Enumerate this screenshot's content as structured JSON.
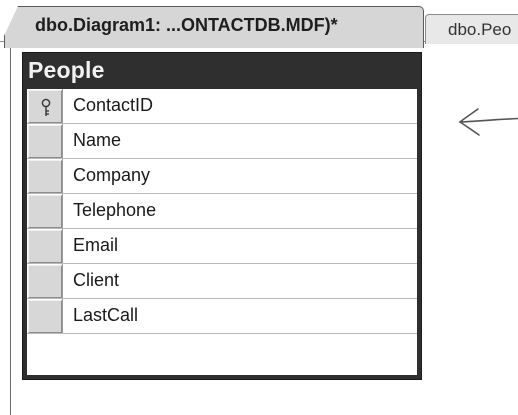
{
  "tabs": {
    "active_label": "dbo.Diagram1: ...ONTACTDB.MDF)*",
    "inactive_label": "dbo.Peo"
  },
  "table": {
    "title": "People",
    "columns": [
      {
        "name": "ContactID",
        "primary_key": true
      },
      {
        "name": "Name",
        "primary_key": false
      },
      {
        "name": "Company",
        "primary_key": false
      },
      {
        "name": "Telephone",
        "primary_key": false
      },
      {
        "name": "Email",
        "primary_key": false
      },
      {
        "name": "Client",
        "primary_key": false
      },
      {
        "name": "LastCall",
        "primary_key": false
      }
    ]
  },
  "icons": {
    "primary_key": "key-icon",
    "annotation": "arrow-left-icon"
  },
  "colors": {
    "table_header_bg": "#2f2f2f",
    "tab_active_bg": "#d6d6d6",
    "row_selector_bg": "#d7d7d7"
  }
}
